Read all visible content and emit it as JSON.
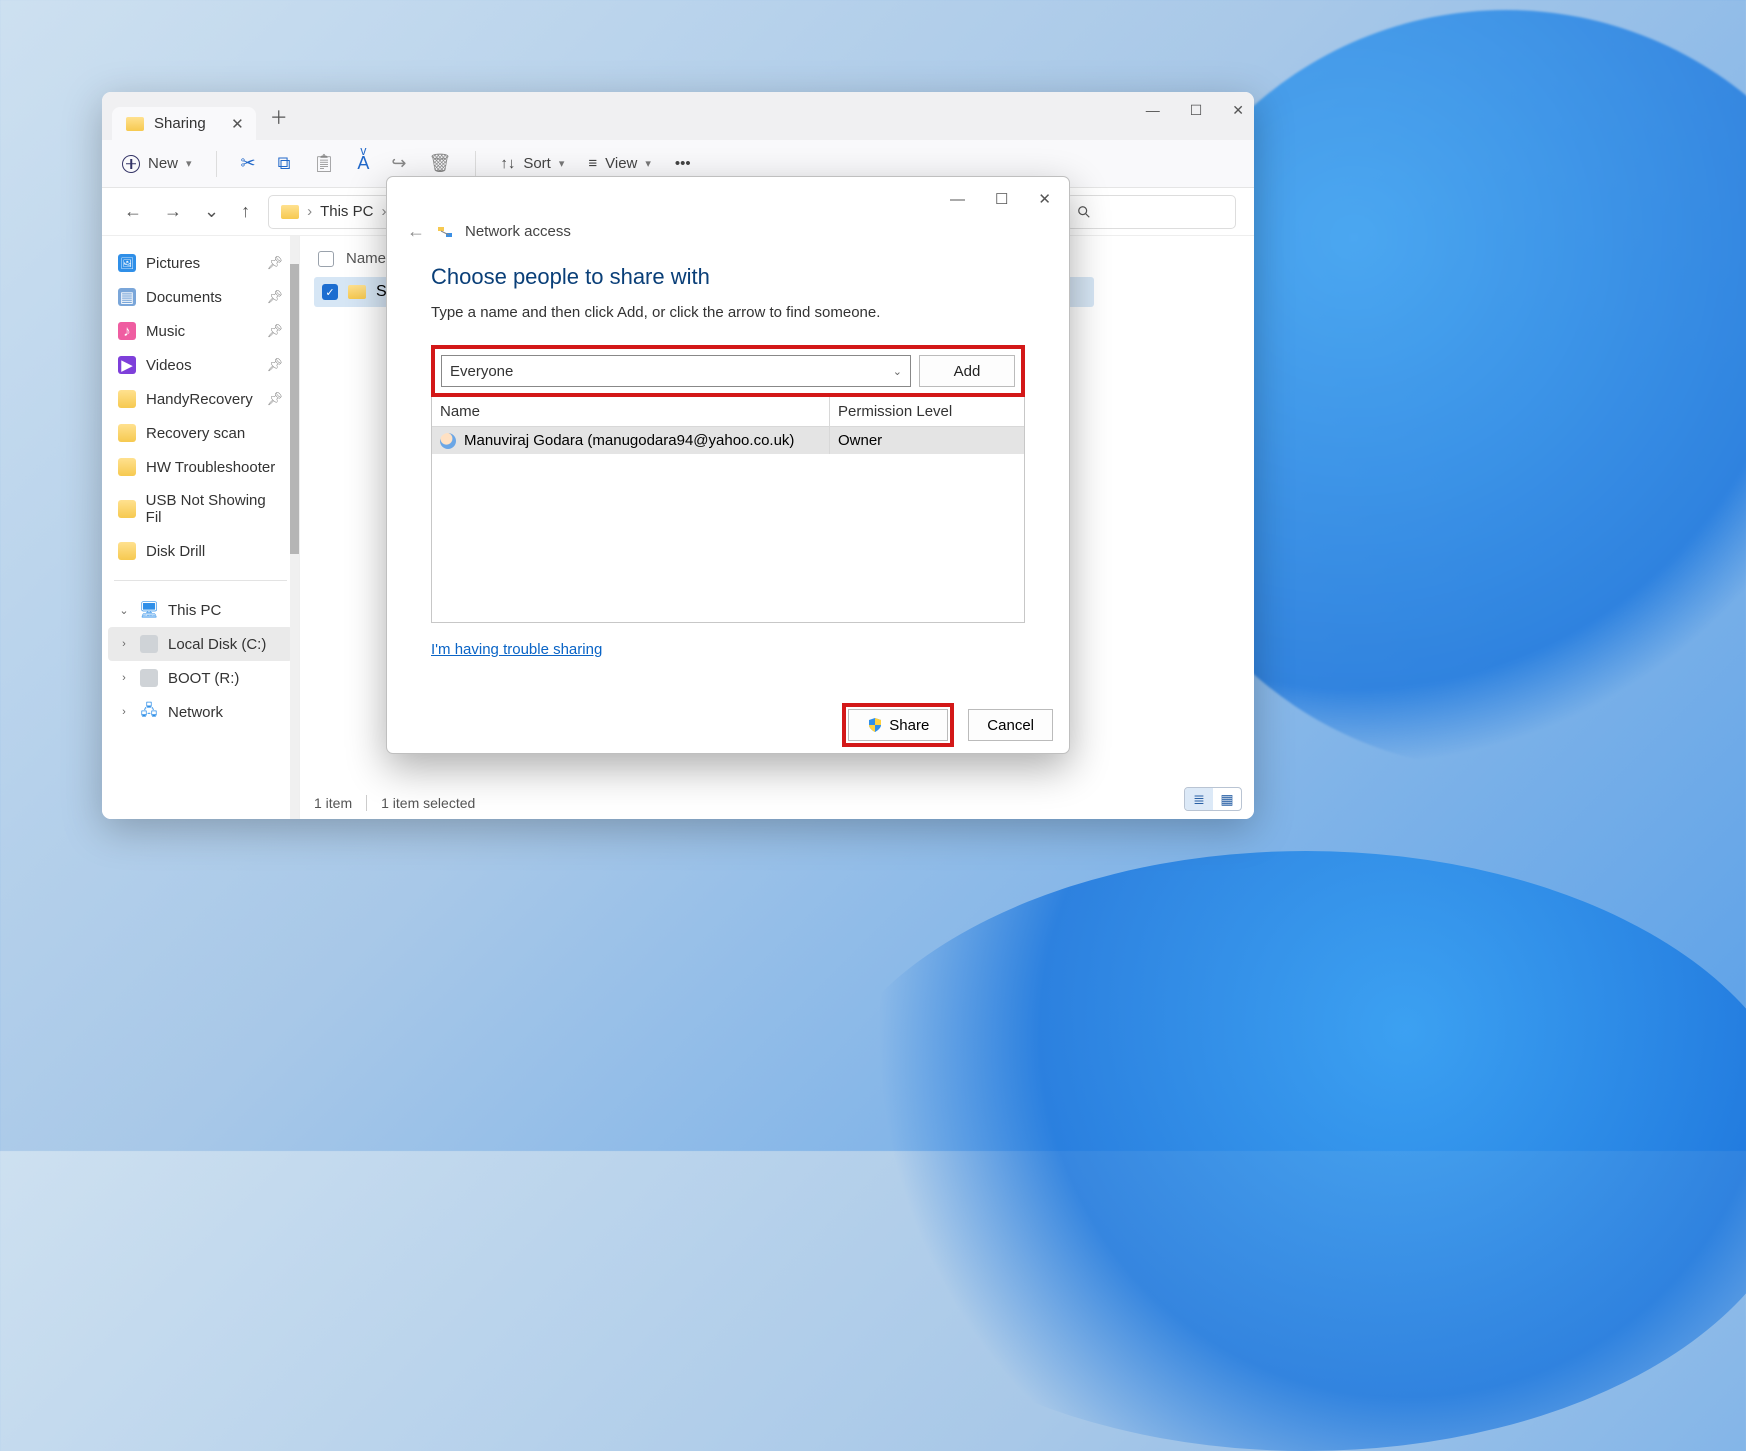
{
  "explorer": {
    "tab_title": "Sharing",
    "new_label": "New",
    "sort_label": "Sort",
    "view_label": "View",
    "breadcrumb": {
      "loc1": "This PC"
    },
    "status": {
      "count": "1 item",
      "selected": "1 item selected"
    },
    "list": {
      "header_name": "Name",
      "row0_name": "Sharing"
    }
  },
  "sidebar": {
    "pictures": "Pictures",
    "documents": "Documents",
    "music": "Music",
    "videos": "Videos",
    "handy": "HandyRecovery",
    "recovery": "Recovery scan",
    "hw": "HW Troubleshooter",
    "usb": "USB Not Showing Fil",
    "diskdrill": "Disk Drill",
    "thispc": "This PC",
    "localdisk": "Local Disk (C:)",
    "boot": "BOOT (R:)",
    "network": "Network"
  },
  "dialog": {
    "title_bar": "Network access",
    "heading": "Choose people to share with",
    "subheading": "Type a name and then click Add, or click the arrow to find someone.",
    "name_value": "Everyone",
    "add_label": "Add",
    "col_name": "Name",
    "col_perm": "Permission Level",
    "user0_name": "Manuviraj Godara (manugodara94@yahoo.co.uk)",
    "user0_perm": "Owner",
    "trouble": "I'm having trouble sharing",
    "share_btn": "Share",
    "cancel_btn": "Cancel"
  }
}
